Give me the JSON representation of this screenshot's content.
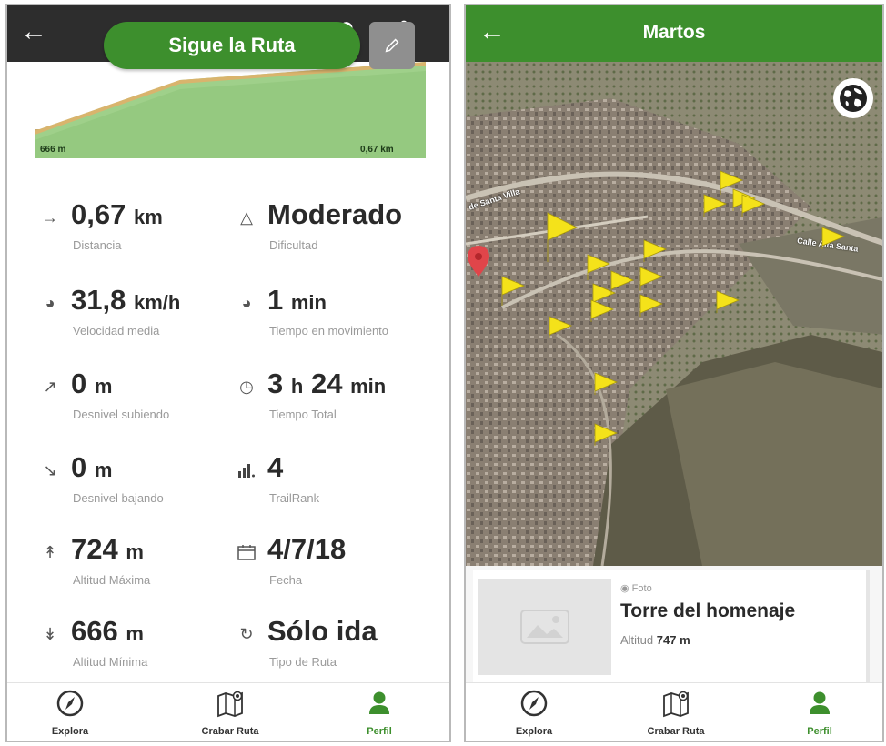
{
  "left": {
    "title": "Martos",
    "follow_label": "Sigue la Ruta",
    "elev_min": "666 m",
    "elev_dist": "0,67 km",
    "stats": [
      {
        "icon": "distance-arrow-icon",
        "value": "0,67",
        "unit": "km",
        "label": "Distancia"
      },
      {
        "icon": "difficulty-triangle-icon",
        "value": "Moderado",
        "unit": "",
        "label": "Dificultad"
      },
      {
        "icon": "speed-gauge-icon",
        "value": "31,8",
        "unit": "km/h",
        "label": "Velocidad media"
      },
      {
        "icon": "moving-time-gauge-icon",
        "value": "1",
        "unit": "min",
        "label": "Tiempo en movimiento"
      },
      {
        "icon": "ascent-arrow-icon",
        "value": "0",
        "unit": "m",
        "label": "Desnivel subiendo"
      },
      {
        "icon": "clock-icon",
        "value": "3",
        "unit": "h",
        "value2": "24",
        "unit2": "min",
        "label": "Tiempo Total"
      },
      {
        "icon": "descent-arrow-icon",
        "value": "0",
        "unit": "m",
        "label": "Desnivel bajando"
      },
      {
        "icon": "trailrank-bars-icon",
        "value": "4",
        "unit": "",
        "label": "TrailRank"
      },
      {
        "icon": "max-altitude-icon",
        "value": "724",
        "unit": "m",
        "label": "Altitud Máxima"
      },
      {
        "icon": "calendar-icon",
        "value": "4/7/18",
        "unit": "",
        "label": "Fecha"
      },
      {
        "icon": "min-altitude-icon",
        "value": "666",
        "unit": "m",
        "label": "Altitud Mínima"
      },
      {
        "icon": "loop-arrow-icon",
        "value": "Sólo ida",
        "unit": "",
        "label": "Tipo de Ruta"
      }
    ]
  },
  "right": {
    "title": "Martos",
    "street_1": "de Santa Villa",
    "street_2": "Calle Alta Santa",
    "poi": {
      "type_label": "Foto",
      "name": "Torre del homenaje",
      "alt_label": "Altitud",
      "alt_value": "747 m"
    }
  },
  "nav": {
    "explore": "Explora",
    "record": "Crabar Ruta",
    "profile": "Perfil"
  },
  "colors": {
    "brand_green": "#3d8f2d",
    "dark_bar": "#2d2d2d",
    "flag_yellow": "#f4e21a",
    "pin_red": "#e0454a"
  }
}
